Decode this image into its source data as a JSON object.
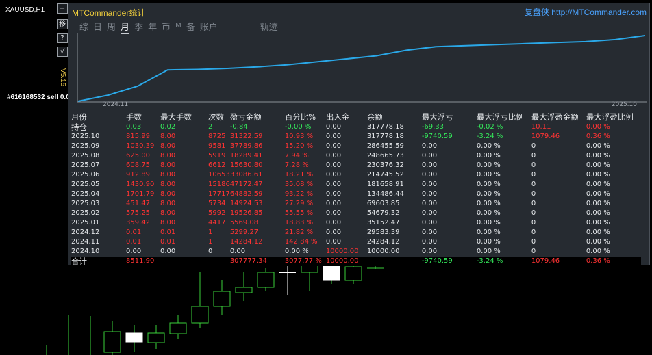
{
  "chart_bg": {
    "symbol": "XAUUSD,H1",
    "version": "V5.15",
    "order_label": "#616168532 sell 0.02",
    "side_buttons": [
      {
        "name": "minimize-button",
        "glyph": "−"
      },
      {
        "name": "move-button",
        "glyph": "移"
      },
      {
        "name": "help-button",
        "glyph": "?"
      },
      {
        "name": "check-button",
        "glyph": "√"
      }
    ]
  },
  "panel": {
    "title": "MTCommander统计",
    "brand_name": "复盘侠",
    "brand_url": "http://MTCommander.com",
    "tabs": [
      "综",
      "日",
      "周",
      "月",
      "季",
      "年",
      "币",
      "M",
      "备",
      "账户",
      "",
      "轨迹"
    ],
    "active_tab": "月",
    "equity_curve": {
      "x_start": "2024.11",
      "x_end": "2025.10",
      "y": [
        0,
        12,
        30,
        62,
        63,
        65,
        68,
        72,
        78,
        84,
        90,
        101,
        108,
        110,
        112,
        114,
        116,
        118,
        122,
        130
      ]
    },
    "headers": [
      "月份",
      "手数",
      "最大手数",
      "次数",
      "盈亏金额",
      "百分比%",
      "出入金",
      "余额",
      "最大浮亏",
      "最大浮亏比例",
      "最大浮盈金额",
      "最大浮盈比例"
    ],
    "rows": [
      {
        "month": "持仓",
        "lots": "0.03",
        "maxlots": "0.02",
        "count": "2",
        "pnl": "-0.84",
        "pct": "-0.00 %",
        "flow": "0.00",
        "balance": "317778.18",
        "maxdd": "-69.33",
        "maxddpct": "-0.02 %",
        "maxfp": "10.11",
        "maxfppct": "0.00 %",
        "type": "open"
      },
      {
        "month": "2025.10",
        "lots": "815.99",
        "maxlots": "8.00",
        "count": "8725",
        "pnl": "31322.59",
        "pct": "10.93 %",
        "flow": "0.00",
        "balance": "317778.18",
        "maxdd": "-9740.59",
        "maxddpct": "-3.24 %",
        "maxfp": "1079.46",
        "maxfppct": "0.36 %",
        "type": "hl"
      },
      {
        "month": "2025.09",
        "lots": "1030.39",
        "maxlots": "8.00",
        "count": "9581",
        "pnl": "37789.86",
        "pct": "15.20 %",
        "flow": "0.00",
        "balance": "286455.59",
        "maxdd": "0.00",
        "maxddpct": "0.00 %",
        "maxfp": "0",
        "maxfppct": "0.00 %"
      },
      {
        "month": "2025.08",
        "lots": "625.00",
        "maxlots": "8.00",
        "count": "5919",
        "pnl": "18289.41",
        "pct": "7.94 %",
        "flow": "0.00",
        "balance": "248665.73",
        "maxdd": "0.00",
        "maxddpct": "0.00 %",
        "maxfp": "0",
        "maxfppct": "0.00 %"
      },
      {
        "month": "2025.07",
        "lots": "608.75",
        "maxlots": "8.00",
        "count": "6612",
        "pnl": "15630.80",
        "pct": "7.28 %",
        "flow": "0.00",
        "balance": "230376.32",
        "maxdd": "0.00",
        "maxddpct": "0.00 %",
        "maxfp": "0",
        "maxfppct": "0.00 %"
      },
      {
        "month": "2025.06",
        "lots": "912.89",
        "maxlots": "8.00",
        "count": "10653",
        "pnl": "33086.61",
        "pct": "18.21 %",
        "flow": "0.00",
        "balance": "214745.52",
        "maxdd": "0.00",
        "maxddpct": "0.00 %",
        "maxfp": "0",
        "maxfppct": "0.00 %"
      },
      {
        "month": "2025.05",
        "lots": "1430.90",
        "maxlots": "8.00",
        "count": "15186",
        "pnl": "47172.47",
        "pct": "35.08 %",
        "flow": "0.00",
        "balance": "181658.91",
        "maxdd": "0.00",
        "maxddpct": "0.00 %",
        "maxfp": "0",
        "maxfppct": "0.00 %"
      },
      {
        "month": "2025.04",
        "lots": "1701.79",
        "maxlots": "8.00",
        "count": "17717",
        "pnl": "64882.59",
        "pct": "93.22 %",
        "flow": "0.00",
        "balance": "134486.44",
        "maxdd": "0.00",
        "maxddpct": "0.00 %",
        "maxfp": "0",
        "maxfppct": "0.00 %"
      },
      {
        "month": "2025.03",
        "lots": "451.47",
        "maxlots": "8.00",
        "count": "5734",
        "pnl": "14924.53",
        "pct": "27.29 %",
        "flow": "0.00",
        "balance": "69603.85",
        "maxdd": "0.00",
        "maxddpct": "0.00 %",
        "maxfp": "0",
        "maxfppct": "0.00 %"
      },
      {
        "month": "2025.02",
        "lots": "575.25",
        "maxlots": "8.00",
        "count": "5992",
        "pnl": "19526.85",
        "pct": "55.55 %",
        "flow": "0.00",
        "balance": "54679.32",
        "maxdd": "0.00",
        "maxddpct": "0.00 %",
        "maxfp": "0",
        "maxfppct": "0.00 %"
      },
      {
        "month": "2025.01",
        "lots": "359.42",
        "maxlots": "8.00",
        "count": "4417",
        "pnl": "5569.08",
        "pct": "18.83 %",
        "flow": "0.00",
        "balance": "35152.47",
        "maxdd": "0.00",
        "maxddpct": "0.00 %",
        "maxfp": "0",
        "maxfppct": "0.00 %"
      },
      {
        "month": "2024.12",
        "lots": "0.01",
        "maxlots": "0.01",
        "count": "1",
        "pnl": "5299.27",
        "pct": "21.82 %",
        "flow": "0.00",
        "balance": "29583.39",
        "maxdd": "0.00",
        "maxddpct": "0.00 %",
        "maxfp": "0",
        "maxfppct": "0.00 %"
      },
      {
        "month": "2024.11",
        "lots": "0.01",
        "maxlots": "0.01",
        "count": "1",
        "pnl": "14284.12",
        "pct": "142.84 %",
        "flow": "0.00",
        "balance": "24284.12",
        "maxdd": "0.00",
        "maxddpct": "0.00 %",
        "maxfp": "0",
        "maxfppct": "0.00 %"
      },
      {
        "month": "2024.10",
        "lots": "0.00",
        "maxlots": "0.00",
        "count": "0",
        "pnl": "0.00",
        "pct": "0.00 %",
        "flow": "10000.00",
        "balance": "10000.00",
        "maxdd": "0.00",
        "maxddpct": "0.00 %",
        "maxfp": "0",
        "maxfppct": "0.00 %",
        "type": "first"
      }
    ],
    "total": {
      "month": "合计",
      "lots": "8511.90",
      "maxlots": "",
      "count": "",
      "pnl": "307777.34",
      "pct": "3077.77 %",
      "flow": "10000.00",
      "balance": "",
      "maxdd": "-9740.59",
      "maxddpct": "-3.24 %",
      "maxfp": "1079.46",
      "maxfppct": "0.36 %"
    }
  },
  "colors": {
    "panel_bg": "#262b31",
    "curve": "#2aa8e8",
    "profit": "#ff3333",
    "loss": "#34e85a",
    "title": "#f2cf3c",
    "candle": "#3ad13a"
  }
}
